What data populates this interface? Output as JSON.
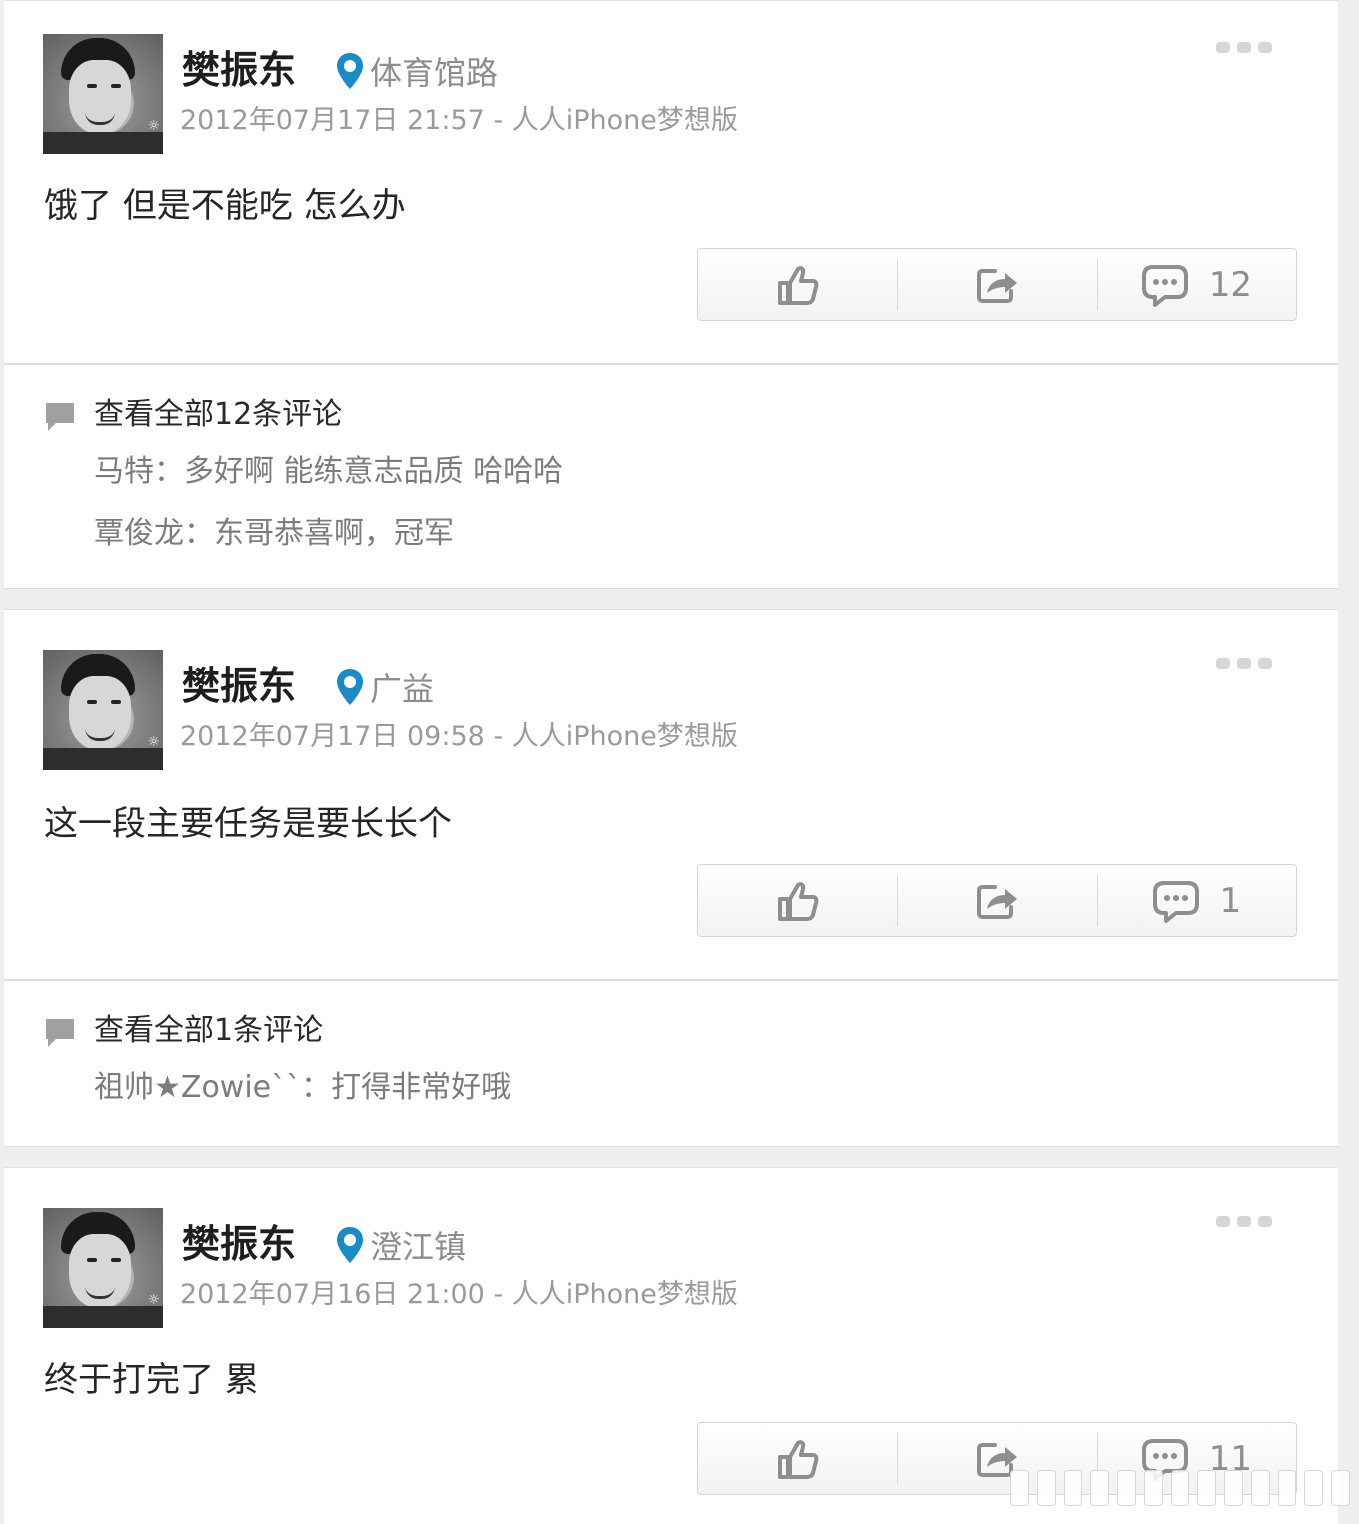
{
  "posts": [
    {
      "username": "樊振东",
      "location": "体育馆路",
      "meta": "2012年07月17日 21:57 - 人人iPhone梦想版",
      "content": "饿了 但是不能吃 怎么办",
      "comment_count": "12",
      "view_all": "查看全部12条评论",
      "comments": [
        "马特：多好啊 能练意志品质 哈哈哈",
        "覃俊龙：东哥恭喜啊，冠军"
      ]
    },
    {
      "username": "樊振东",
      "location": "广益",
      "meta": "2012年07月17日 09:58 - 人人iPhone梦想版",
      "content": "这一段主要任务是要长长个",
      "comment_count": "1",
      "view_all": "查看全部1条评论",
      "comments": [
        "祖帅★Zowie``：打得非常好哦"
      ]
    },
    {
      "username": "樊振东",
      "location": "澄江镇",
      "meta": "2012年07月16日 21:00 - 人人iPhone梦想版",
      "content": "终于打完了 累",
      "comment_count": "11"
    }
  ],
  "icons": {
    "like": "thumbs-up-icon",
    "share": "share-icon",
    "comment": "comment-icon",
    "location": "location-pin-icon",
    "more": "more-dots-icon"
  },
  "colors": {
    "location_pin": "#1a8bc6",
    "icon_gray": "#8e8e8e",
    "background": "#eeeeee"
  }
}
